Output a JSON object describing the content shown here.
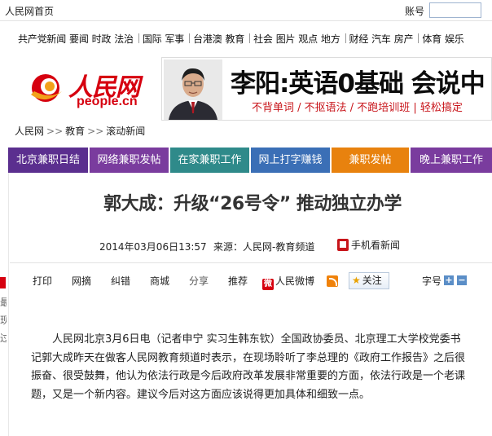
{
  "topbar": {
    "home_link": "人民网首页",
    "account_label": "账号",
    "account_value": ""
  },
  "channels": [
    [
      "共产党新闻",
      "要闻",
      "时政",
      "法治"
    ],
    [
      "国际",
      "军事"
    ],
    [
      "台港澳",
      "教育"
    ],
    [
      "社会",
      "图片",
      "观点",
      "地方"
    ],
    [
      "财经",
      "汽车",
      "房产"
    ],
    [
      "体育",
      "娱乐"
    ]
  ],
  "logo": {
    "cn": "人民网",
    "en": "people.cn"
  },
  "banner": {
    "headline": "李阳:英语0基础 会说中",
    "sub": "不背单词 / 不抠语法 / 不跑培训班 | 轻松搞定"
  },
  "breadcrumb": [
    "人民网",
    "教育",
    "滚动新闻"
  ],
  "promo_tabs": [
    {
      "label": "北京兼职日结",
      "color": "#5b2f8f"
    },
    {
      "label": "网络兼职发帖",
      "color": "#7a3c9e"
    },
    {
      "label": "在家兼职工作",
      "color": "#2f8a8a"
    },
    {
      "label": "网上打字赚钱",
      "color": "#3b6fb6"
    },
    {
      "label": "兼职发帖",
      "color": "#e8820e"
    },
    {
      "label": "晚上兼职工作",
      "color": "#7a3c9e"
    }
  ],
  "article": {
    "title": "郭大成：升级“26号令”  推动独立办学",
    "date": "2014年03月06日13:57",
    "source": "来源：人民网-教育频道",
    "mobile": "手机看新闻",
    "body": "人民网北京3月6日电（记者申宁 实习生韩东钦）全国政协委员、北京理工大学校党委书记郭大成昨天在做客人民网教育频道时表示，在现场聆听了李总理的《政府工作报告》之后很振奋、很受鼓舞，他认为依法行政是今后政府改革发展非常重要的方面，依法行政是一个老课题，又是一个新内容。建议今后对这方面应该说得更加具体和细致一点。"
  },
  "tools": {
    "print": "打印",
    "net_excerpt": "网摘",
    "correct": "纠错",
    "business": "商城",
    "share": "分享",
    "recommend": "推荐",
    "weibo": "人民微博",
    "follow": "关注",
    "font_size": "字号",
    "plus": "+",
    "minus": "−"
  },
  "sidebar_fragments": [
    "最",
    "现",
    "过"
  ],
  "colors": {
    "brand_red": "#d6000f",
    "title_gray": "#333333"
  }
}
